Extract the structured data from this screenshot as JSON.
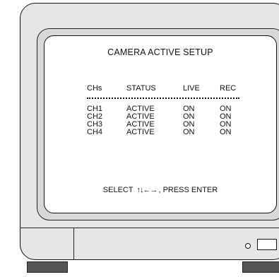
{
  "screen": {
    "title": "CAMERA ACTIVE SETUP",
    "columns": [
      "CHs",
      "STATUS",
      "LIVE",
      "REC"
    ],
    "rows": [
      {
        "ch": "CH1",
        "status": "ACTIVE",
        "live": "ON",
        "rec": "ON"
      },
      {
        "ch": "CH2",
        "status": "ACTIVE",
        "live": "ON",
        "rec": "ON"
      },
      {
        "ch": "CH3",
        "status": "ACTIVE",
        "live": "ON",
        "rec": "ON"
      },
      {
        "ch": "CH4",
        "status": "ACTIVE",
        "live": "ON",
        "rec": "ON"
      }
    ],
    "footer": {
      "select": "SELECT",
      "arrows": "↑↓←→",
      "press": ", PRESS ENTER"
    }
  },
  "icons": {
    "led": "power-led-icon",
    "power": "power-button-icon"
  }
}
